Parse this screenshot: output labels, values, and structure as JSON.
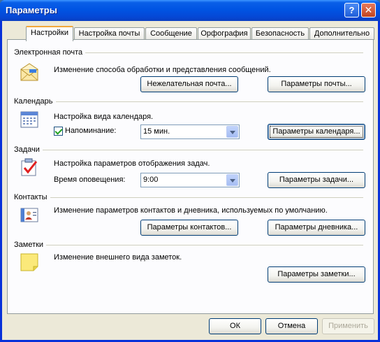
{
  "window": {
    "title": "Параметры"
  },
  "titlebar": {
    "help_glyph": "?",
    "close_glyph": "✕"
  },
  "tabs": [
    {
      "label": "Настройки",
      "active": true
    },
    {
      "label": "Настройка почты",
      "active": false
    },
    {
      "label": "Сообщение",
      "active": false
    },
    {
      "label": "Орфография",
      "active": false
    },
    {
      "label": "Безопасность",
      "active": false
    },
    {
      "label": "Дополнительно",
      "active": false
    }
  ],
  "email": {
    "title": "Электронная почта",
    "desc": "Изменение способа обработки и представления сообщений.",
    "junk_button": "Нежелательная почта...",
    "options_button": "Параметры почты...",
    "icon": "envelope-icon"
  },
  "calendar": {
    "title": "Календарь",
    "desc": "Настройка вида календаря.",
    "reminder_label": "Напоминание:",
    "reminder_checked": true,
    "reminder_value": "15 мин.",
    "options_button": "Параметры календаря...",
    "icon": "calendar-icon"
  },
  "tasks": {
    "title": "Задачи",
    "desc": "Настройка параметров отображения задач.",
    "time_label": "Время оповещения:",
    "time_value": "9:00",
    "options_button": "Параметры задачи...",
    "icon": "task-icon"
  },
  "contacts": {
    "title": "Контакты",
    "desc": "Изменение параметров контактов и дневника, используемых  по умолчанию.",
    "contacts_button": "Параметры контактов...",
    "journal_button": "Параметры дневника...",
    "icon": "contact-card-icon"
  },
  "notes": {
    "title": "Заметки",
    "desc": "Изменение внешнего вида заметок.",
    "options_button": "Параметры заметки...",
    "icon": "note-icon"
  },
  "footer": {
    "ok": "ОК",
    "cancel": "Отмена",
    "apply": "Применить"
  },
  "colors": {
    "titlebar": "#0054e3",
    "window_bg": "#ece9d8",
    "active_tab_accent": "#f3a83b"
  }
}
